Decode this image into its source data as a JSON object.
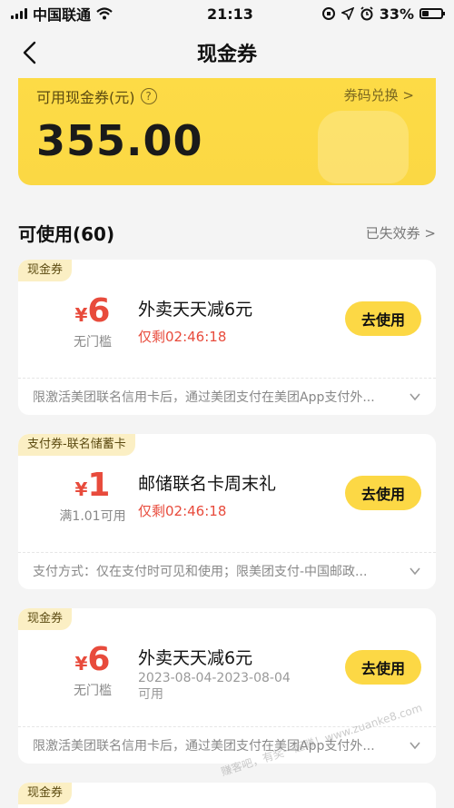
{
  "status_bar": {
    "carrier": "中国联通",
    "time": "21:13",
    "battery": "33%",
    "battery_level": 0.33
  },
  "nav": {
    "title": "现金券"
  },
  "balance": {
    "label": "可用现金券(元)",
    "help": "?",
    "redeem": "券码兑换 >",
    "amount": "355.00"
  },
  "section": {
    "title": "可使用(60)",
    "expired": "已失效券 >"
  },
  "coupons": [
    {
      "tag": "现金券",
      "yen": "¥",
      "amount": "6",
      "condition": "无门槛",
      "name": "外卖天天减6元",
      "countdown": "仅剩02:46:18",
      "button": "去使用",
      "desc": "限激活美团联名信用卡后，通过美团支付在美团App支付外..."
    },
    {
      "tag": "支付券-联名储蓄卡",
      "yen": "¥",
      "amount": "1",
      "condition": "满1.01可用",
      "name": "邮储联名卡周末礼",
      "countdown": "仅剩02:46:18",
      "button": "去使用",
      "desc": "支付方式：仅在支付时可见和使用；限美团支付-中国邮政..."
    },
    {
      "tag": "现金券",
      "yen": "¥",
      "amount": "6",
      "condition": "无门槛",
      "name": "外卖天天减6元",
      "validity_1": "2023-08-04-2023-08-04",
      "validity_2": "可用",
      "button": "去使用",
      "desc": "限激活美团联名信用卡后，通过美团支付在美团App支付外..."
    },
    {
      "tag": "现金券"
    }
  ],
  "watermark": "赚客吧，有奖一起赚！www.zuanke8.com",
  "colors": {
    "accent_yellow": "#fcd845",
    "price_red": "#e84b3c",
    "background": "#f4f4f4"
  }
}
